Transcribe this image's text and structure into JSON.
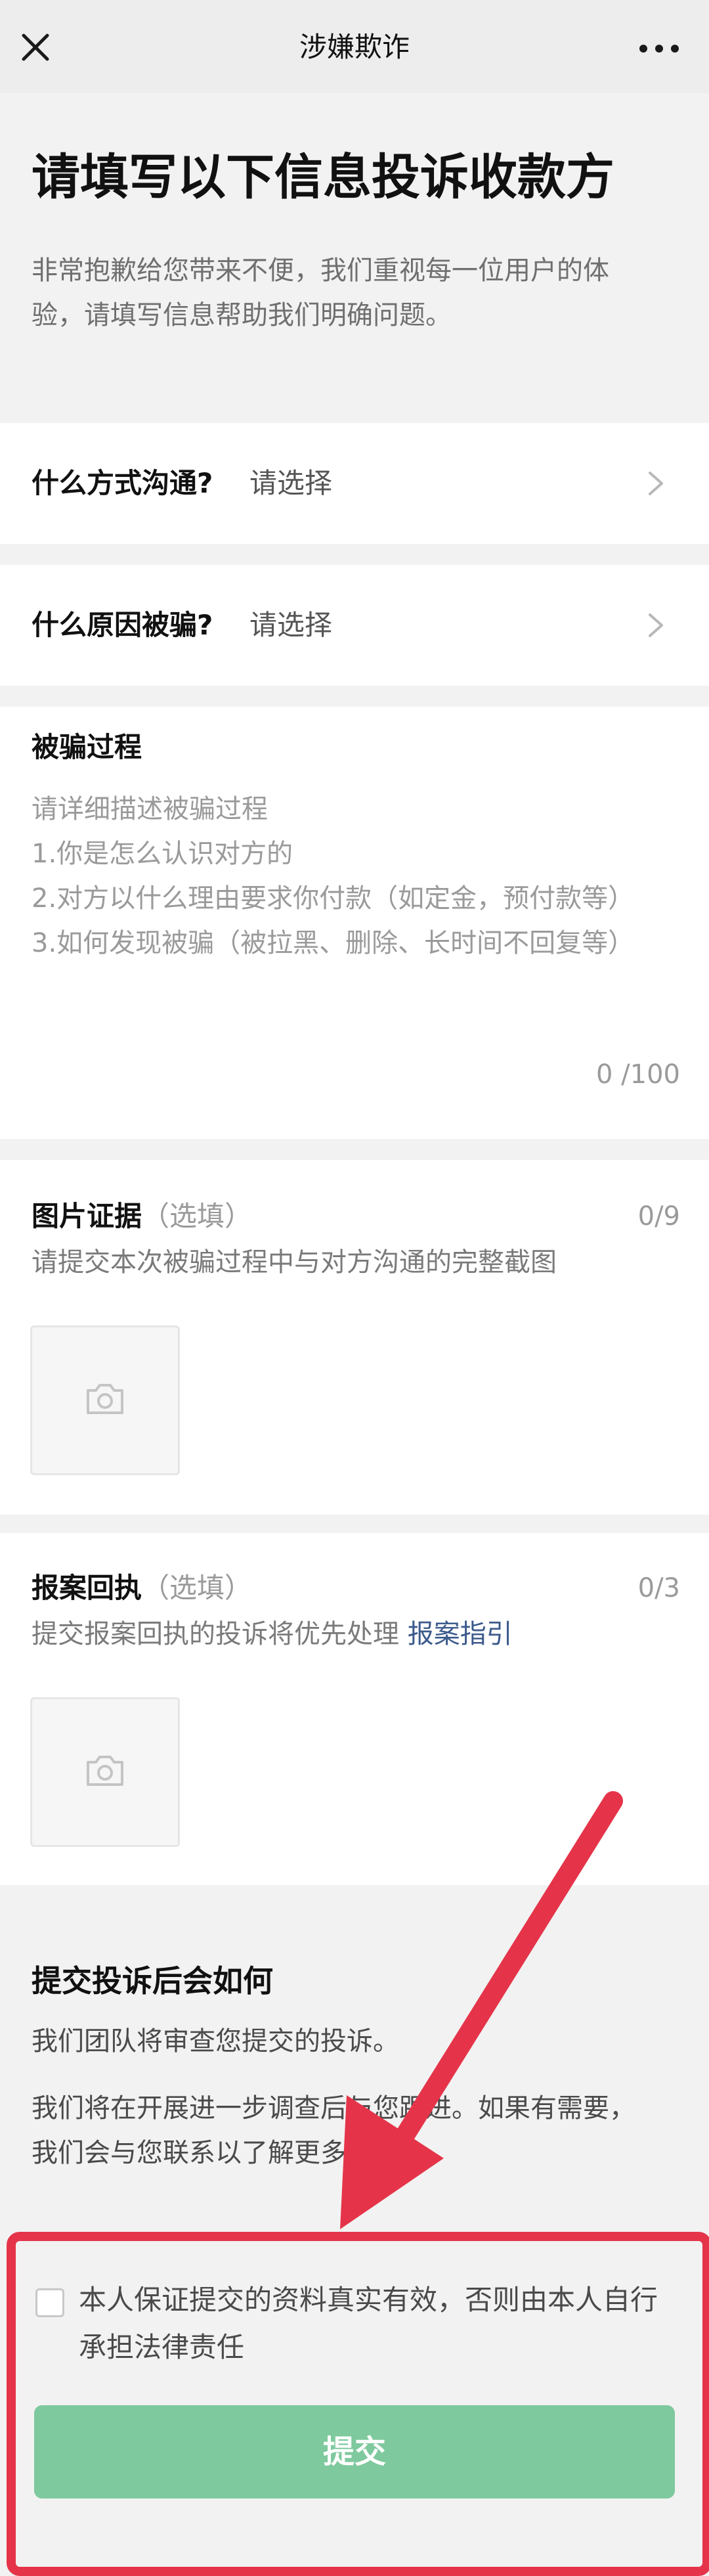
{
  "navbar": {
    "title": "涉嫌欺诈",
    "close_icon": "close-icon",
    "more_icon": "more-icon"
  },
  "header": {
    "title": "请填写以下信息投诉收款方",
    "intro_line1": "非常抱歉给您带来不便，我们重视每一位用户的体",
    "intro_line2": "验，请填写信息帮助我们明确问题。"
  },
  "contact_method": {
    "label": "什么方式沟通?",
    "value": "请选择"
  },
  "fraud_reason": {
    "label": "什么原因被骗?",
    "value": "请选择"
  },
  "process": {
    "title": "被骗过程",
    "placeholder_lines": [
      "请详细描述被骗过程",
      "1.你是怎么认识对方的",
      "2.对方以什么理由要求你付款（如定金，预付款等）",
      "3.如何发现被骗（被拉黑、删除、长时间不回复等）"
    ],
    "counter": "0 /100"
  },
  "photo_evidence": {
    "title": "图片证据",
    "optional": "（选填）",
    "counter": "0/9",
    "description": "请提交本次被骗过程中与对方沟通的完整截图",
    "upload_icon": "camera-icon"
  },
  "police_receipt": {
    "title": "报案回执",
    "optional": "（选填）",
    "counter": "0/3",
    "description": "提交报案回执的投诉将优先处理 ",
    "guide_link": "报案指引",
    "upload_icon": "camera-icon"
  },
  "after_submit": {
    "title": "提交投诉后会如何",
    "para1": "我们团队将审查您提交的投诉。",
    "para2_line1": "我们将在开展进一步调查后与您跟进。如果有需要，",
    "para2_line2": "我们会与您联系以了解更多信息"
  },
  "agreement": {
    "line1": "本人保证提交的资料真实有效，否则由本人自行",
    "line2": "承担法律责任",
    "checked": false
  },
  "submit": {
    "label": "提交"
  },
  "colors": {
    "background": "#f2f2f2",
    "card": "#ffffff",
    "submit_button": "#7fc99e",
    "annotation_red": "#e53449",
    "link": "#3c5a8c"
  }
}
